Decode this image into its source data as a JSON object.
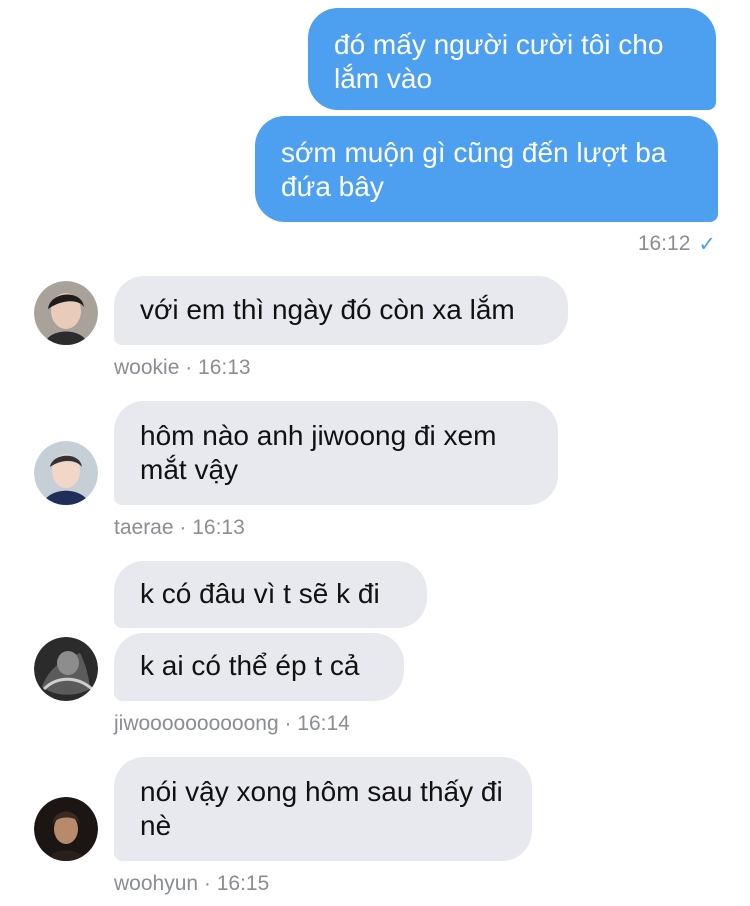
{
  "messages": {
    "out1": "đó mấy người cười tôi cho lắm vào",
    "out2": "sớm muộn gì cũng đến lượt ba đứa bây",
    "out_time": "16:12",
    "in1": "với em thì ngày đó còn xa lắm",
    "in1_meta": "wookie · 16:13",
    "in2": "hôm nào anh jiwoong đi xem mắt vậy",
    "in2_meta": "taerae · 16:13",
    "in3a": "k có đâu vì t sẽ k đi",
    "in3b": "k ai có thể ép t cả",
    "in3_meta": "jiwoooooooooong · 16:14",
    "in4": "nói vậy xong hôm sau thấy đi nè",
    "in4_meta": "woohyun · 16:15"
  },
  "icons": {
    "read_check": "check-icon"
  },
  "colors": {
    "outgoing_bubble": "#4da0f0",
    "incoming_bubble": "#e8e9ee",
    "meta_text": "#8a8d93"
  }
}
